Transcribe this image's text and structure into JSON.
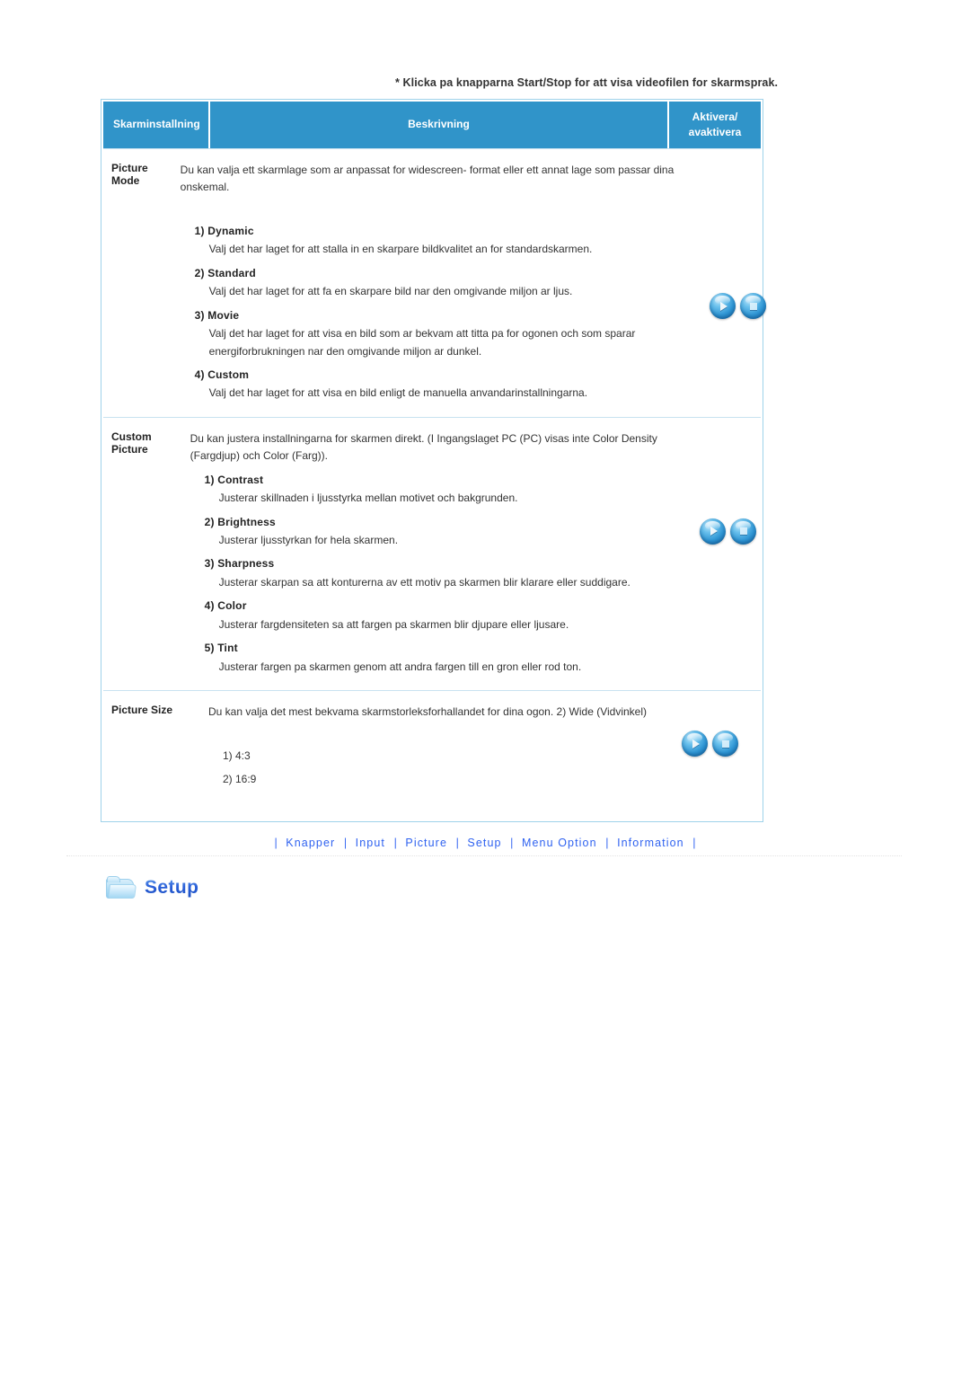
{
  "note": "* Klicka pa knapparna Start/Stop for att visa videofilen for skarmsprak.",
  "table": {
    "headers": {
      "setting": "Skarminstallning",
      "description": "Beskrivning",
      "activate_line1": "Aktivera/",
      "activate_line2": "avaktivera"
    },
    "rows": [
      {
        "setting": "Picture Mode",
        "lead": "Du kan valja ett skarmlage som ar anpassat for widescreen- format eller ett annat lage som passar dina onskemal.",
        "options": [
          {
            "title": "1) Dynamic",
            "desc": "Valj det har laget for att stalla in en skarpare bildkvalitet an for standardskarmen."
          },
          {
            "title": "2) Standard",
            "desc": "Valj det har laget for att fa en skarpare bild nar den omgivande miljon ar ljus."
          },
          {
            "title": "3) Movie",
            "desc": "Valj det har laget for att visa en bild som ar bekvam att titta pa for ogonen och som sparar energiforbrukningen    nar den omgivande miljon ar dunkel."
          },
          {
            "title": "4) Custom",
            "desc": "Valj det har laget for att visa en bild enligt de manuella anvandarinstallningarna."
          }
        ]
      },
      {
        "setting": "Custom Picture",
        "lead": "Du kan justera installningarna for skarmen direkt. (I Ingangslaget PC (PC) visas inte Color Density (Fargdjup) och Color (Farg)).",
        "options": [
          {
            "title": "1) Contrast",
            "desc": "Justerar skillnaden i ljusstyrka mellan motivet och bakgrunden."
          },
          {
            "title": "2) Brightness",
            "desc": "Justerar ljusstyrkan for hela skarmen."
          },
          {
            "title": "3) Sharpness",
            "desc": "Justerar skarpan sa att konturerna av ett motiv pa skarmen blir klarare eller suddigare."
          },
          {
            "title": "4) Color",
            "desc": "Justerar fargdensiteten sa att fargen pa skarmen blir djupare eller ljusare."
          },
          {
            "title": "5) Tint",
            "desc": "Justerar fargen pa skarmen genom att andra fargen till en gron eller rod ton."
          }
        ]
      },
      {
        "setting": "Picture Size",
        "lead": "Du kan valja det mest bekvama skarmstorleksforhallandet for dina ogon. 2) Wide (Vidvinkel)",
        "plain_options": [
          "1) 4:3",
          "2) 16:9"
        ]
      }
    ],
    "buttons": {
      "start_label": "Start",
      "stop_label": "Stop"
    }
  },
  "footer": {
    "links": [
      "Knapper",
      "Input",
      "Picture",
      "Setup",
      "Menu Option",
      "Information"
    ],
    "separator": "|"
  },
  "logo": {
    "label": "Setup",
    "icon": "folder-icon"
  },
  "colors": {
    "header_blue": "#3094c9",
    "border_blue": "#9fd2ea",
    "row_divider": "#c8e2f0",
    "link_blue": "#2f62f0"
  }
}
